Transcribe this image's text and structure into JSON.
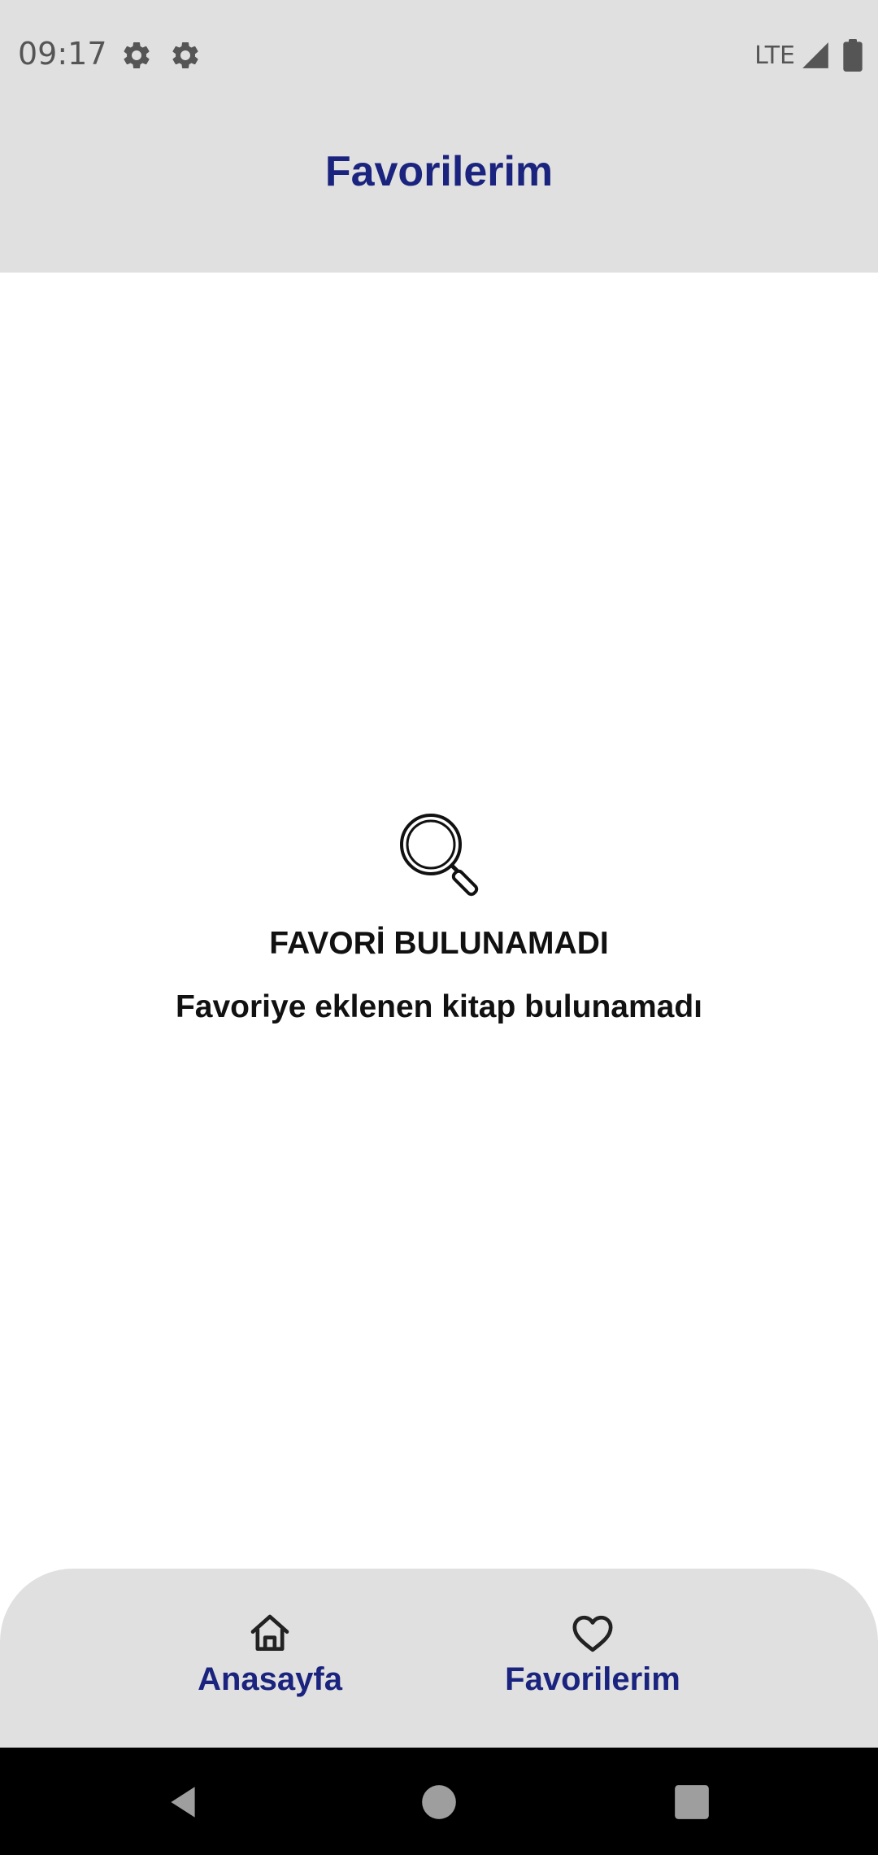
{
  "status_bar": {
    "time": "09:17",
    "network": "LTE",
    "icons": [
      "gear-icon",
      "gear-icon",
      "signal-icon",
      "battery-icon"
    ]
  },
  "app_bar": {
    "title": "Favorilerim"
  },
  "empty_state": {
    "icon": "search-icon",
    "title": "FAVORİ BULUNAMADI",
    "subtitle": "Favoriye eklenen kitap bulunamadı"
  },
  "bottom_nav": {
    "items": [
      {
        "label": "Anasayfa",
        "icon": "home-icon"
      },
      {
        "label": "Favorilerim",
        "icon": "heart-icon"
      }
    ]
  },
  "system_nav": {
    "icons": [
      "back-icon",
      "home-circle-icon",
      "recents-icon"
    ]
  },
  "colors": {
    "accent": "#1a237e",
    "bar_background": "#e0e0e0",
    "text": "#111111"
  }
}
